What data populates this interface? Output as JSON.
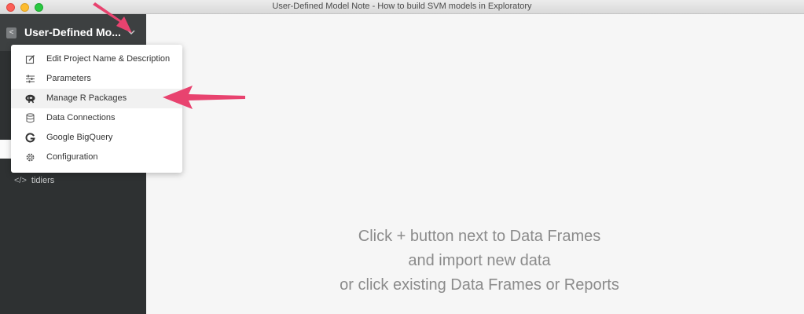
{
  "window": {
    "title": "User-Defined Model Note - How to build SVM models in Exploratory"
  },
  "sidebar": {
    "back_icon": "<",
    "project_title": "User-Defined Mo...",
    "items": [
      {
        "icon": "code-icon",
        "label": "tidiers"
      }
    ]
  },
  "project_menu": {
    "items": [
      {
        "icon": "edit-icon",
        "label": "Edit Project Name & Description"
      },
      {
        "icon": "sliders-icon",
        "label": "Parameters"
      },
      {
        "icon": "r-logo-icon",
        "label": "Manage R Packages",
        "highlighted": true
      },
      {
        "icon": "database-icon",
        "label": "Data Connections"
      },
      {
        "icon": "google-icon",
        "label": "Google BigQuery"
      },
      {
        "icon": "gear-icon",
        "label": "Configuration"
      }
    ]
  },
  "main": {
    "empty_lines": [
      "Click + button next to Data Frames",
      "and import new data",
      "or click existing Data Frames or Reports"
    ]
  },
  "annotations": {
    "arrow_color": "#e8436f"
  }
}
